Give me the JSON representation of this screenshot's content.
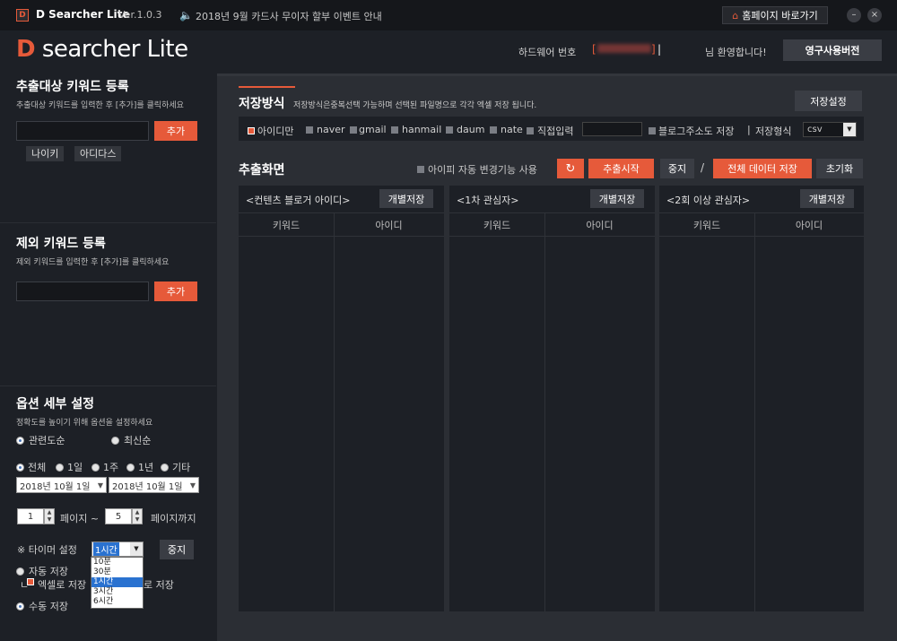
{
  "titlebar": {
    "app_icon": "D",
    "app_name": "D Searcher Lite",
    "version": "Ver.1.0.3",
    "notice_icon": "speaker-icon",
    "notice": "2018년 9월 카드사 무이자 할부 이벤트 안내",
    "home_button": "홈페이지 바로가기",
    "home_icon": "house-icon",
    "minimize": "–",
    "close": "×"
  },
  "header": {
    "logo_d": "D",
    "logo_text": " searcher",
    "logo_lite": " Lite",
    "hw_label": "하드웨어 번호",
    "bracket_open": "[",
    "bracket_close": "]",
    "separator": "|",
    "welcome": "님 환영합니다!",
    "license_button": "영구사용버전"
  },
  "keyword_register": {
    "title": "추출대상 키워드 등록",
    "desc": "추출대상 키워드를 입력한 후 [추가]를 클릭하세요",
    "add_button": "추가",
    "tags": [
      "나이키",
      "아디다스"
    ]
  },
  "exclude_register": {
    "title": "제외 키워드 등록",
    "desc": "제외 키워드를 입력한 후 [추가]를 클릭하세요",
    "add_button": "추가"
  },
  "options": {
    "title": "옵션 세부 설정",
    "desc": "정확도를 높이기 위해 옵션을 설정하세요",
    "sort_relevance": "관련도순",
    "sort_latest": "최신순",
    "period": [
      "전체",
      "1일",
      "1주",
      "1년",
      "기타"
    ],
    "date_from": "2018년 10월  1일",
    "date_to": "2018년 10월  1일",
    "page_from": "1",
    "page_label": "페이지 ~",
    "page_to": "5",
    "page_to_label": "페이지까지",
    "timer_label": "※ 타이머 설정",
    "timer_value": "1시간",
    "timer_stop": "중지",
    "timer_options": [
      "10분",
      "30분",
      "1시간",
      "3시간",
      "6시간"
    ],
    "auto_save": "자동 저장",
    "excel_prefix": "ㄴ",
    "excel_save": "엑셀로 저장",
    "excel_save_tail": "로 저장",
    "manual_save": "수동 저장"
  },
  "save_method": {
    "title": "저장방식",
    "desc": "저장방식은중복선택 가능하며 선택된 파일명으로 각각 엑셀 저장 됩니다.",
    "settings_button": "저장설정",
    "checks": [
      "아이디만",
      "naver",
      "gmail",
      "hanmail",
      "daum",
      "nate",
      "직접입력"
    ],
    "blog_address": "블로그주소도 저장",
    "pipe": "|",
    "format_label": "저장형식",
    "format_value": "csv"
  },
  "extract": {
    "title": "추출화면",
    "auto_change": "아이피 자동 변경기능 사용",
    "start_button": "추출시작",
    "stop_button": "중지",
    "slash": "/",
    "save_all_button": "전체 데이터 저장",
    "reset_button": "초기화",
    "columns": [
      {
        "label": "<컨텐츠 블로거 아이디>",
        "save": "개별저장",
        "h1": "키워드",
        "h2": "아이디"
      },
      {
        "label": "<1차 관심자>",
        "save": "개별저장",
        "h1": "키워드",
        "h2": "아이디"
      },
      {
        "label": "<2회 이상 관심자>",
        "save": "개별저장",
        "h1": "키워드",
        "h2": "아이디"
      }
    ]
  },
  "colors": {
    "accent": "#e65a3a",
    "background": "#1d2026",
    "panel": "#2b2e34"
  }
}
